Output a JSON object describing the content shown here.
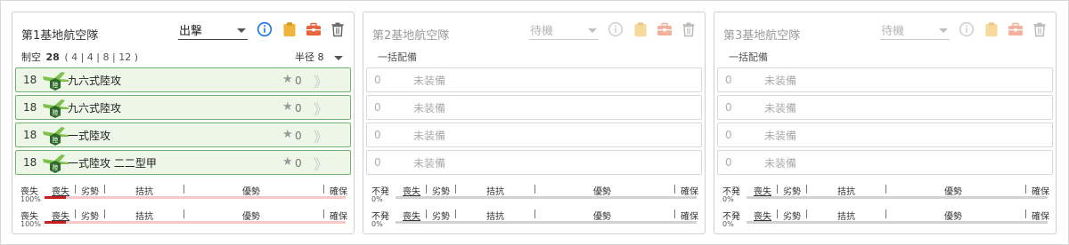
{
  "panels": [
    {
      "title": "第1基地航空隊",
      "mode": "出撃",
      "air_power_label": "制空",
      "air_power_value": "28",
      "air_power_detail": "( 4 | 4 | 8 | 12 )",
      "radius_label": "半径",
      "radius_value": "8",
      "slots": [
        {
          "count": "18",
          "name": "九六式陸攻",
          "star": "★",
          "level": "0",
          "chevron": "》"
        },
        {
          "count": "18",
          "name": "九六式陸攻",
          "star": "★",
          "level": "0",
          "chevron": "》"
        },
        {
          "count": "18",
          "name": "一式陸攻",
          "star": "★",
          "level": "0",
          "chevron": "》"
        },
        {
          "count": "18",
          "name": "一式陸攻 二二型甲",
          "star": "★",
          "level": "0",
          "chevron": "》"
        }
      ],
      "bars": [
        {
          "first": "喪失",
          "pct": "100%",
          "fill_ratio": 0.07
        },
        {
          "first": "喪失",
          "pct": "100%",
          "fill_ratio": 0.07
        }
      ]
    },
    {
      "title": "第2基地航空隊",
      "mode": "待機",
      "bulk_label": "一括配備",
      "slots": [
        {
          "count": "0",
          "name": "未装備"
        },
        {
          "count": "0",
          "name": "未装備"
        },
        {
          "count": "0",
          "name": "未装備"
        },
        {
          "count": "0",
          "name": "未装備"
        }
      ],
      "bars": [
        {
          "first": "不発",
          "pct": "0%",
          "fill_ratio": 0
        },
        {
          "first": "不発",
          "pct": "0%",
          "fill_ratio": 0
        }
      ]
    },
    {
      "title": "第3基地航空隊",
      "mode": "待機",
      "bulk_label": "一括配備",
      "slots": [
        {
          "count": "0",
          "name": "未装備"
        },
        {
          "count": "0",
          "name": "未装備"
        },
        {
          "count": "0",
          "name": "未装備"
        },
        {
          "count": "0",
          "name": "未装備"
        }
      ],
      "bars": [
        {
          "first": "不発",
          "pct": "0%",
          "fill_ratio": 0
        },
        {
          "first": "不発",
          "pct": "0%",
          "fill_ratio": 0
        }
      ]
    }
  ],
  "bar_labels": {
    "loss": "喪失",
    "inferior": "劣勢",
    "parity": "拮抗",
    "superior": "優勢",
    "supremacy": "確保"
  },
  "colors": {
    "info_blue": "#1a73e8",
    "clipboard": "#f0b43a",
    "toolbox": "#e8643c",
    "slot_green": "#6fb56f",
    "loss_red": "#c81e1e"
  },
  "icons": [
    "info-icon",
    "clipboard-icon",
    "toolbox-icon",
    "trash-icon",
    "plane-icon",
    "star-icon",
    "chevron-right-icon"
  ]
}
